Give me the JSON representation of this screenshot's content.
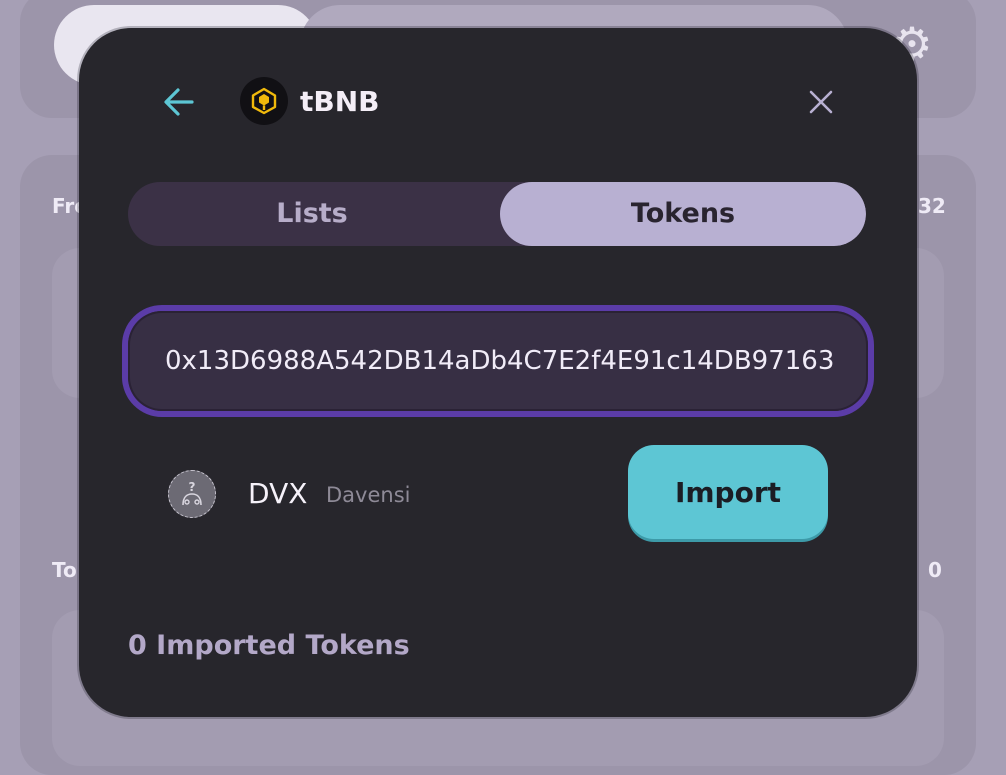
{
  "background": {
    "label_from": "Fro",
    "label_to": "To",
    "balance_top": "32",
    "balance_bottom": "0"
  },
  "modal": {
    "chain": {
      "name": "tBNB",
      "icon": "bnb-logo-icon"
    },
    "tabs": [
      {
        "label": "Lists",
        "active": false
      },
      {
        "label": "Tokens",
        "active": true
      }
    ],
    "search": {
      "value": "0x13D6988A542DB14aDb4C7E2f4E91c14DB97163"
    },
    "token": {
      "symbol": "DVX",
      "name": "Davensi",
      "icon": "unknown-token-icon",
      "import_label": "Import"
    },
    "imported_count_label": "0 Imported Tokens"
  },
  "colors": {
    "modal_bg": "#27262c",
    "accent_cyan": "#5dc6d4",
    "tab_active": "#b8b0d2",
    "focus_ring": "#5b3ca8"
  }
}
